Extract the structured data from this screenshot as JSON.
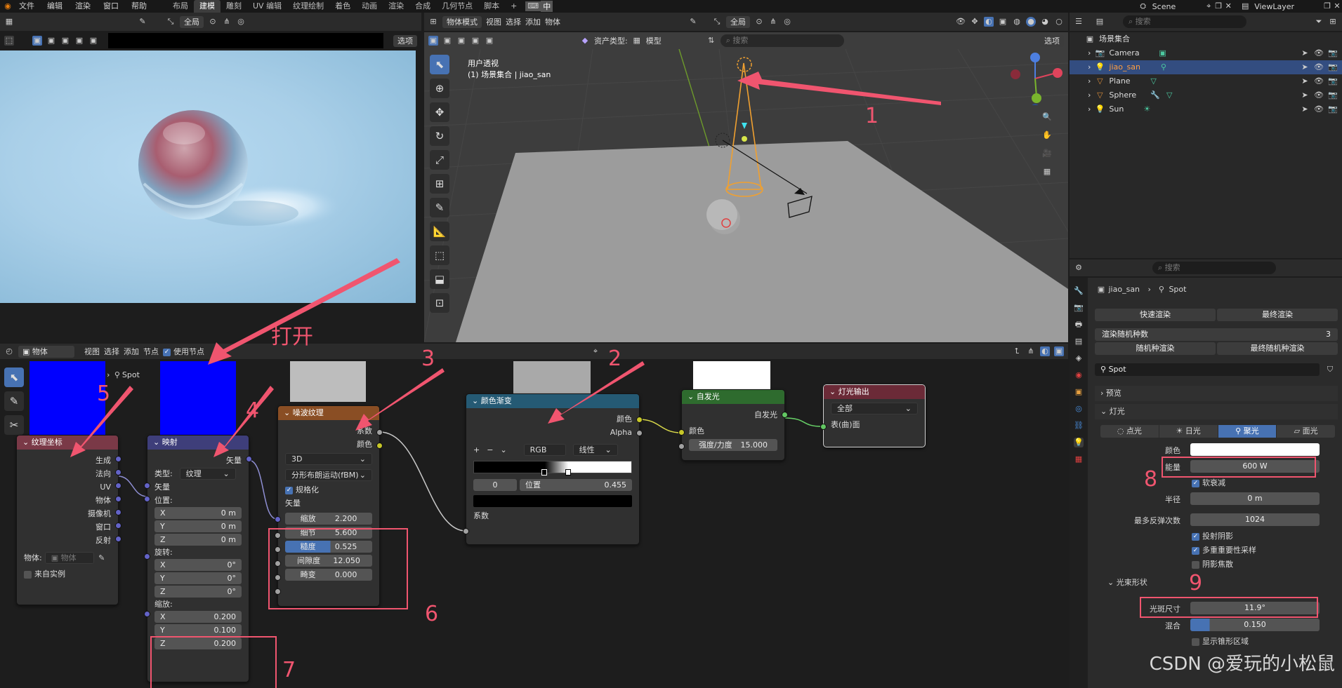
{
  "topmenu": {
    "menus": [
      "文件",
      "编辑",
      "渲染",
      "窗口",
      "帮助"
    ],
    "workspaces": [
      "布局",
      "建模",
      "雕刻",
      "UV 编辑",
      "纹理绘制",
      "着色",
      "动画",
      "渲染",
      "合成",
      "几何节点",
      "脚本"
    ],
    "active_ws": "建模",
    "lang": "中",
    "scene": "Scene",
    "viewlayer": "ViewLayer"
  },
  "render_header": {
    "mode": "全局",
    "options": "选项"
  },
  "viewport": {
    "mode": "物体模式",
    "menus": [
      "视图",
      "选择",
      "添加",
      "物体"
    ],
    "mode_label": "全局",
    "options": "选项",
    "asset_type_label": "资产类型:",
    "asset_type": "模型",
    "search_placeholder": "搜索",
    "title": "用户透视",
    "subtitle": "(1) 场景集合 | jiao_san"
  },
  "outliner": {
    "search_placeholder": "搜索",
    "root": "场景集合",
    "items": [
      {
        "name": "Camera",
        "active": false
      },
      {
        "name": "jiao_san",
        "active": true
      },
      {
        "name": "Plane",
        "active": false
      },
      {
        "name": "Sphere",
        "active": false
      },
      {
        "name": "Sun",
        "active": false
      }
    ]
  },
  "node_header": {
    "type": "物体",
    "menus": [
      "视图",
      "选择",
      "添加",
      "节点"
    ],
    "use_nodes": "使用节点",
    "breadcrumb": "Spot"
  },
  "nodes": {
    "texcoord": {
      "title": "纹理坐标",
      "outputs": [
        "生成",
        "法向",
        "UV",
        "物体",
        "摄像机",
        "窗口",
        "反射"
      ],
      "object_label": "物体:",
      "object_placeholder": "物体",
      "from_instance": "来自实例"
    },
    "mapping": {
      "title": "映射",
      "output": "矢量",
      "type_label": "类型:",
      "type": "纹理",
      "input": "矢量",
      "location": "位置:",
      "rotation": "旋转:",
      "scale": "缩放:",
      "loc": [
        [
          "X",
          "0 m"
        ],
        [
          "Y",
          "0 m"
        ],
        [
          "Z",
          "0 m"
        ]
      ],
      "rot": [
        [
          "X",
          "0°"
        ],
        [
          "Y",
          "0°"
        ],
        [
          "Z",
          "0°"
        ]
      ],
      "scl": [
        [
          "X",
          "0.200"
        ],
        [
          "Y",
          "0.100"
        ],
        [
          "Z",
          "0.200"
        ]
      ]
    },
    "noise": {
      "title": "噪波纹理",
      "out_fac": "系数",
      "out_col": "颜色",
      "dim": "3D",
      "type": "分形布朗运动(fBM)",
      "normalize": "规格化",
      "vector": "矢量",
      "fields": [
        [
          "缩放",
          "2.200"
        ],
        [
          "细节",
          "5.600"
        ],
        [
          "糙度",
          "0.525"
        ],
        [
          "间隙度",
          "12.050"
        ],
        [
          "畸变",
          "0.000"
        ]
      ]
    },
    "ramp": {
      "title": "颜色渐变",
      "out_col": "颜色",
      "out_alpha": "Alpha",
      "mode": "RGB",
      "interp": "线性",
      "index": "0",
      "pos_label": "位置",
      "pos": "0.455",
      "input": "系数"
    },
    "emission": {
      "title": "自发光",
      "output": "自发光",
      "in_col": "颜色",
      "strength_label": "强度/力度",
      "strength": "15.000"
    },
    "output": {
      "title": "灯光输出",
      "target": "全部",
      "input": "表(曲)面"
    }
  },
  "props": {
    "search_placeholder": "搜索",
    "obj": "jiao_san",
    "data": "Spot",
    "quick_render": "快速渲染",
    "final_render": "最终渲染",
    "rand_seed_label": "渲染随机种数",
    "rand_seed": "3",
    "rand_render": "随机种渲染",
    "final_rand_render": "最终随机种渲染",
    "light_name": "Spot",
    "preview": "预览",
    "light": "灯光",
    "light_types": [
      "点光",
      "日光",
      "聚光",
      "面光"
    ],
    "active_type": "聚光",
    "color_label": "颜色",
    "power_label": "能量",
    "power": "600 W",
    "soft_falloff": "软衰减",
    "radius_label": "半径",
    "radius": "0 m",
    "bounces_label": "最多反弹次数",
    "bounces": "1024",
    "cast_shadow": "投射阴影",
    "mis": "多重重要性采样",
    "shadow_caustics": "阴影焦散",
    "beam_shape": "光束形状",
    "spot_size_label": "光斑尺寸",
    "spot_size": "11.9°",
    "blend_label": "混合",
    "blend": "0.150",
    "show_cone": "显示锥形区域"
  },
  "annotations": {
    "n1": "1",
    "n2": "2",
    "n3": "3",
    "n4": "4",
    "n5": "5",
    "n6": "6",
    "n7": "7",
    "n8": "8",
    "n9": "9",
    "open": "打开"
  },
  "watermark": "CSDN @爱玩的小松鼠",
  "colors": {
    "accent": "#4772b3",
    "annotation": "#f0556f",
    "vector_node": "#3e3e7a",
    "texture_node": "#8a4e24",
    "converter_node": "#255a74",
    "shader_node": "#2e6b2e",
    "output_node": "#6b2a37"
  }
}
